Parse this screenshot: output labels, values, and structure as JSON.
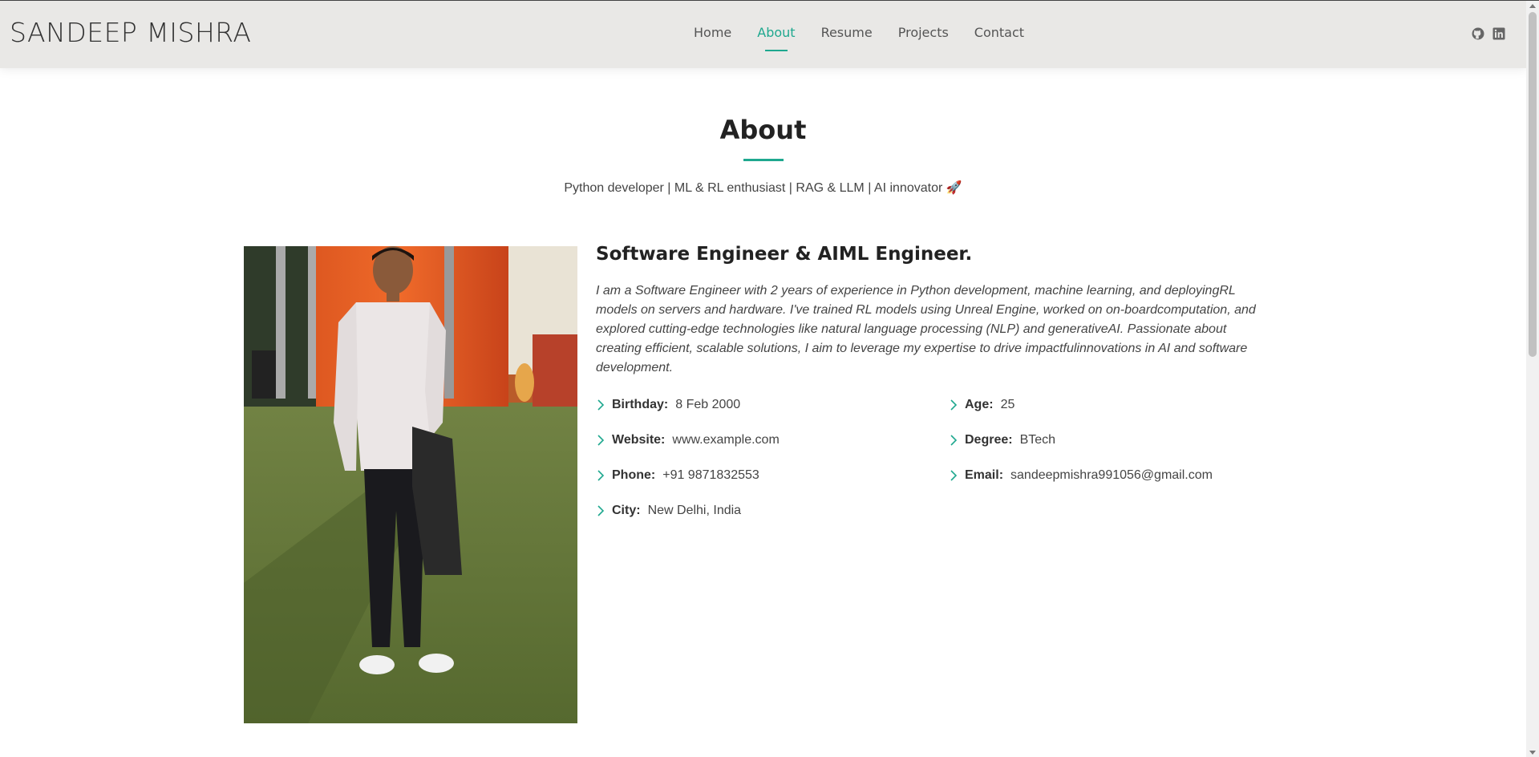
{
  "header": {
    "logo": "SANDEEP MISHRA",
    "nav": [
      {
        "label": "Home",
        "active": false
      },
      {
        "label": "About",
        "active": true
      },
      {
        "label": "Resume",
        "active": false
      },
      {
        "label": "Projects",
        "active": false
      },
      {
        "label": "Contact",
        "active": false
      }
    ],
    "socials": [
      "github-icon",
      "linkedin-icon"
    ]
  },
  "about": {
    "title": "About",
    "subtitle": "Python developer | ML & RL enthusiast | RAG & LLM | AI innovator 🚀",
    "heading": "Software Engineer & AIML Engineer.",
    "bio": "I am a Software Engineer with 2 years of experience in Python development, machine learning, and deployingRL models on servers and hardware. I've trained RL models using Unreal Engine, worked on on-boardcomputation, and explored cutting-edge technologies like natural language processing (NLP) and generativeAI. Passionate about creating efficient, scalable solutions, I aim to leverage my expertise to drive impactfulinnovations in AI and software development.",
    "facts": {
      "birthday": {
        "label": "Birthday:",
        "value": "8 Feb 2000"
      },
      "age": {
        "label": "Age:",
        "value": "25"
      },
      "website": {
        "label": "Website:",
        "value": "www.example.com"
      },
      "degree": {
        "label": "Degree:",
        "value": "BTech"
      },
      "phone": {
        "label": "Phone:",
        "value": "+91 9871832553"
      },
      "email": {
        "label": "Email:",
        "value": "sandeepmishra991056@gmail.com"
      },
      "city": {
        "label": "City:",
        "value": "New Delhi, India"
      }
    }
  },
  "colors": {
    "accent": "#1fa88f",
    "header_bg": "#e9e8e6"
  }
}
